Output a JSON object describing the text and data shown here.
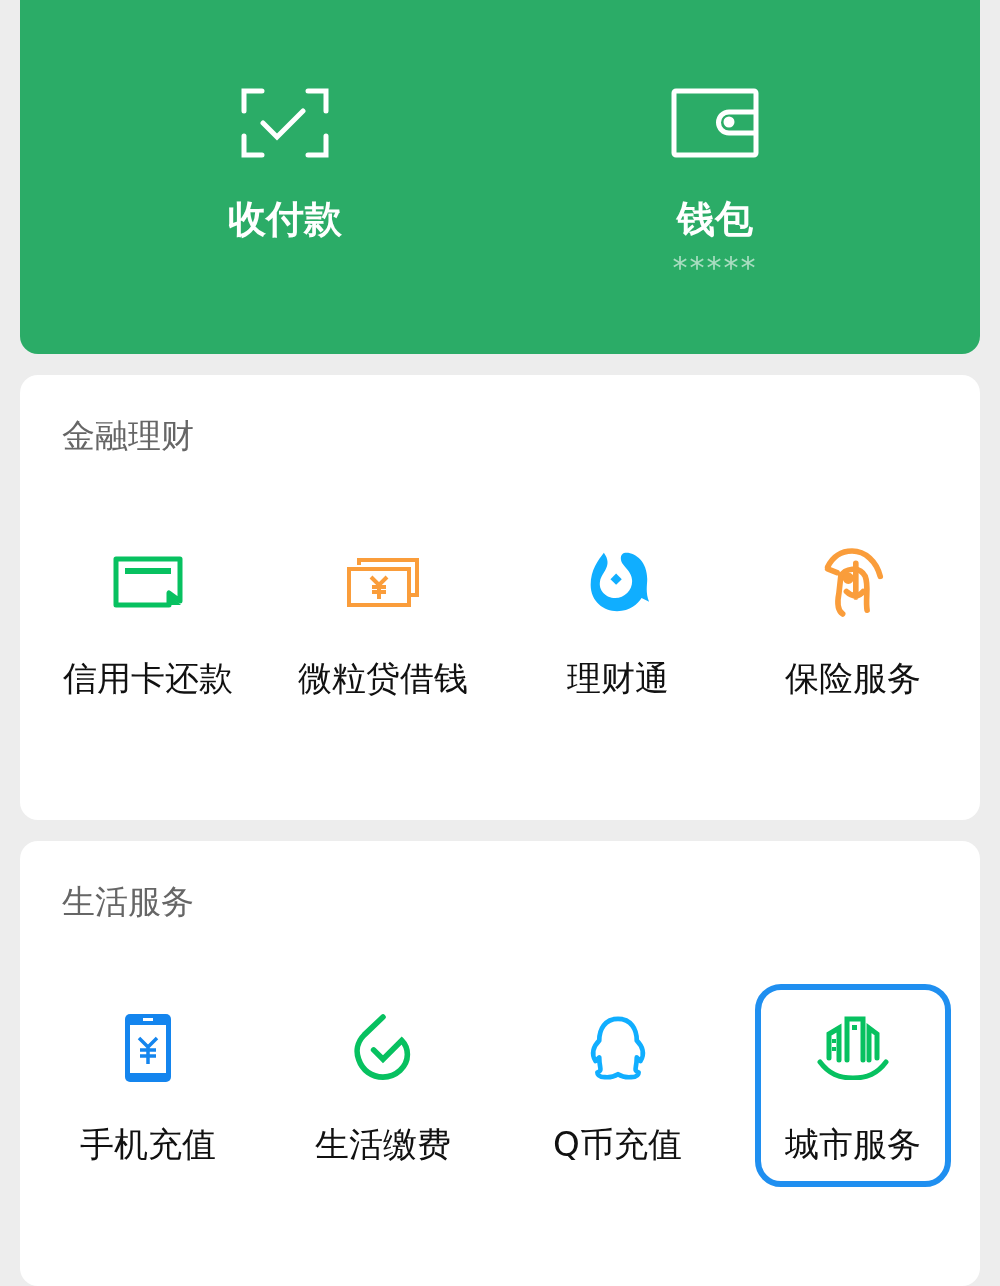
{
  "wallet_panel": {
    "items": [
      {
        "label": "收付款"
      },
      {
        "label": "钱包",
        "subtext": "*****"
      }
    ]
  },
  "sections": [
    {
      "title": "金融理财",
      "items": [
        {
          "label": "信用卡还款",
          "selected": false
        },
        {
          "label": "微粒贷借钱",
          "selected": false
        },
        {
          "label": "理财通",
          "selected": false
        },
        {
          "label": "保险服务",
          "selected": false
        }
      ]
    },
    {
      "title": "生活服务",
      "items": [
        {
          "label": "手机充值",
          "selected": false
        },
        {
          "label": "生活缴费",
          "selected": false
        },
        {
          "label": "Q币充值",
          "selected": false
        },
        {
          "label": "城市服务",
          "selected": true
        }
      ]
    }
  ]
}
